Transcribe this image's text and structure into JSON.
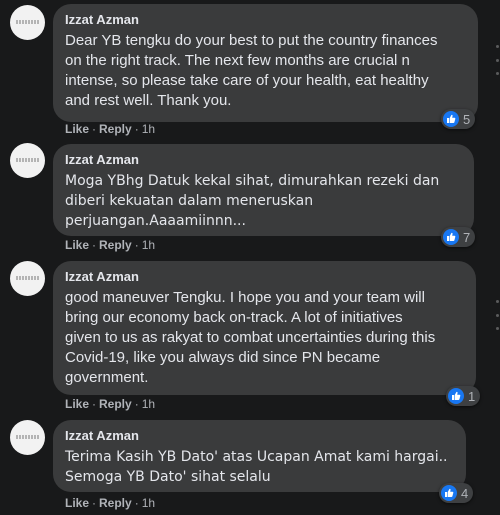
{
  "comments": [
    {
      "author": "Izzat Azman",
      "text": "Dear YB tengku do your best to put the country finances\non the right track. The next few months are crucial n\nintense, so please take care of your health, eat healthy\nand rest well. Thank you.",
      "reaction_count": "5",
      "like_label": "Like",
      "reply_label": "Reply",
      "time": "1h"
    },
    {
      "author": "Izzat Azman",
      "text": "Moga YBhg Datuk kekal sihat, dimurahkan rezeki dan\ndiberi kekuatan dalam meneruskan\nperjuangan.Aaaamiinnn...",
      "reaction_count": "7",
      "like_label": "Like",
      "reply_label": "Reply",
      "time": "1h"
    },
    {
      "author": "Izzat Azman",
      "text": "good maneuver Tengku. I hope you and your team will\nbring our economy back on-track. A lot of initiatives\ngiven to us as rakyat to combat uncertainties during this\nCovid-19, like you always did since PN became\ngovernment.",
      "reaction_count": "1",
      "like_label": "Like",
      "reply_label": "Reply",
      "time": "1h"
    },
    {
      "author": "Izzat Azman",
      "text": "Terima Kasih YB Dato' atas Ucapan Amat kami hargai..\nSemoga YB Dato' sihat selalu",
      "reaction_count": "4",
      "like_label": "Like",
      "reply_label": "Reply",
      "time": "1h"
    }
  ],
  "separator": "·",
  "icons": {
    "reaction": "thumbs-up-icon"
  },
  "colors": {
    "like_blue": "#1877f2",
    "bubble": "#3a3b3c",
    "background": "#18191a"
  }
}
